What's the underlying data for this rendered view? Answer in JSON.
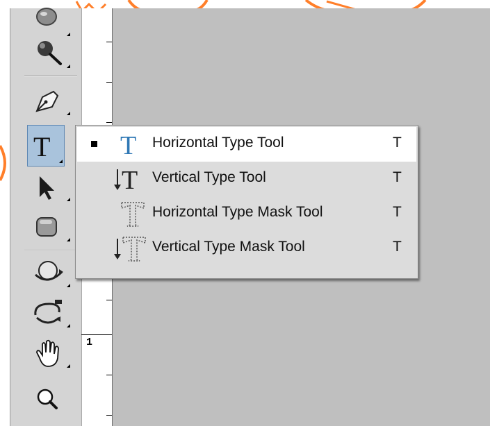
{
  "toolbar": {
    "tools": [
      {
        "name": "burn-tool",
        "icon": "burn-icon"
      },
      {
        "name": "sponge-tool",
        "icon": "sponge-icon"
      },
      {
        "name": "pen-tool",
        "icon": "pen-icon"
      },
      {
        "name": "type-tool",
        "icon": "type-icon",
        "active": true
      },
      {
        "name": "path-selection-tool",
        "icon": "arrow-icon"
      },
      {
        "name": "rectangle-tool",
        "icon": "rounded-rectangle-icon"
      },
      {
        "name": "3d-rotate-tool",
        "icon": "3d-rotate-icon"
      },
      {
        "name": "3d-orbit-tool",
        "icon": "3d-orbit-icon"
      },
      {
        "name": "hand-tool",
        "icon": "hand-icon"
      },
      {
        "name": "zoom-tool",
        "icon": "magnifier-icon"
      }
    ]
  },
  "ruler": {
    "label": "1"
  },
  "flyout": {
    "items": [
      {
        "label": "Horizontal Type Tool",
        "shortcut": "T",
        "selected": true,
        "icon": "horizontal-type-icon"
      },
      {
        "label": "Vertical Type Tool",
        "shortcut": "T",
        "selected": false,
        "icon": "vertical-type-icon"
      },
      {
        "label": "Horizontal Type Mask Tool",
        "shortcut": "T",
        "selected": false,
        "icon": "horizontal-type-mask-icon"
      },
      {
        "label": "Vertical Type Mask Tool",
        "shortcut": "T",
        "selected": false,
        "icon": "vertical-type-mask-icon"
      }
    ]
  },
  "colors": {
    "accent": "#3b7fb8",
    "deco": "#ff7f2a",
    "active_tool_bg": "#a9c3dc"
  }
}
